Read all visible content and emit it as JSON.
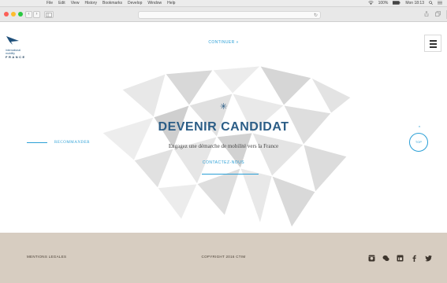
{
  "os_menu": {
    "apple": "",
    "items": [
      "File",
      "Edit",
      "View",
      "History",
      "Bookmarks",
      "Develop",
      "Window",
      "Help"
    ],
    "status": [
      "100%",
      "Mon 18:13"
    ]
  },
  "browser": {
    "reload": "↻"
  },
  "header": {
    "logo_line1": "international",
    "logo_line2": "mobility",
    "logo_country": "FRANCE",
    "continue_label": "CONTINUER »"
  },
  "hero": {
    "emblem": "✳",
    "title": "DEVENIR CANDIDAT",
    "subtitle": "Engagez une démarche de mobilité vers la France",
    "cta": "CONTACTEZ-NOUS"
  },
  "side": {
    "recommend": "RECOMMANDER",
    "top_arrow": "^",
    "top": "TOP"
  },
  "footer": {
    "legal": "MENTIONS LEGALES",
    "copyright": "COPYRIGHT 2016 CTIM",
    "social_icons": [
      "instagram-icon",
      "chat-icon",
      "linkedin-icon",
      "facebook-icon",
      "twitter-icon"
    ]
  },
  "colors": {
    "accent": "#2a9fd6",
    "navy": "#2b5d86",
    "footer_bg": "#d7cdc1"
  }
}
